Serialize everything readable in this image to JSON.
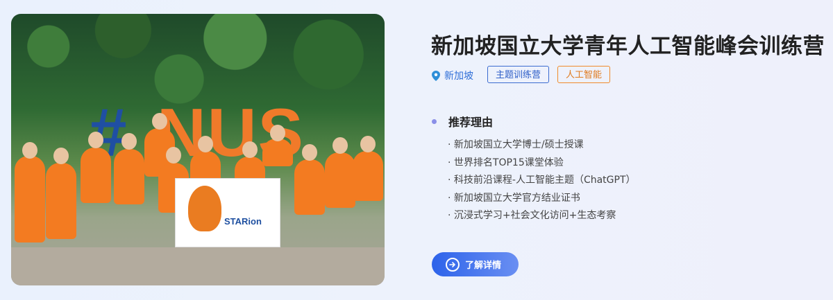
{
  "title": "新加坡国立大学青年人工智能峰会训练营",
  "location": "新加坡",
  "tags": [
    "主题训练营",
    "人工智能"
  ],
  "reason_title": "推荐理由",
  "reasons": [
    "· 新加坡国立大学博士/硕士授课",
    "· 世界排名TOP15课堂体验",
    "· 科技前沿课程-人工智能主题（ChatGPT）",
    "· 新加坡国立大学官方结业证书",
    "· 沉浸式学习+社会文化访问+生态考察"
  ],
  "cta_label": "了解详情",
  "photo": {
    "sign_hash": "#",
    "sign_letters": "NUS",
    "banner_brand": "STARion"
  },
  "colors": {
    "accent_blue": "#2f6fd8",
    "tag_orange": "#f08a2a",
    "cta_start": "#2d63ea",
    "cta_end": "#6a8ff2"
  },
  "icons": {
    "location": "location-pin-icon",
    "cta": "arrow-right-circle-icon",
    "reason_bullet": "dot-icon"
  }
}
